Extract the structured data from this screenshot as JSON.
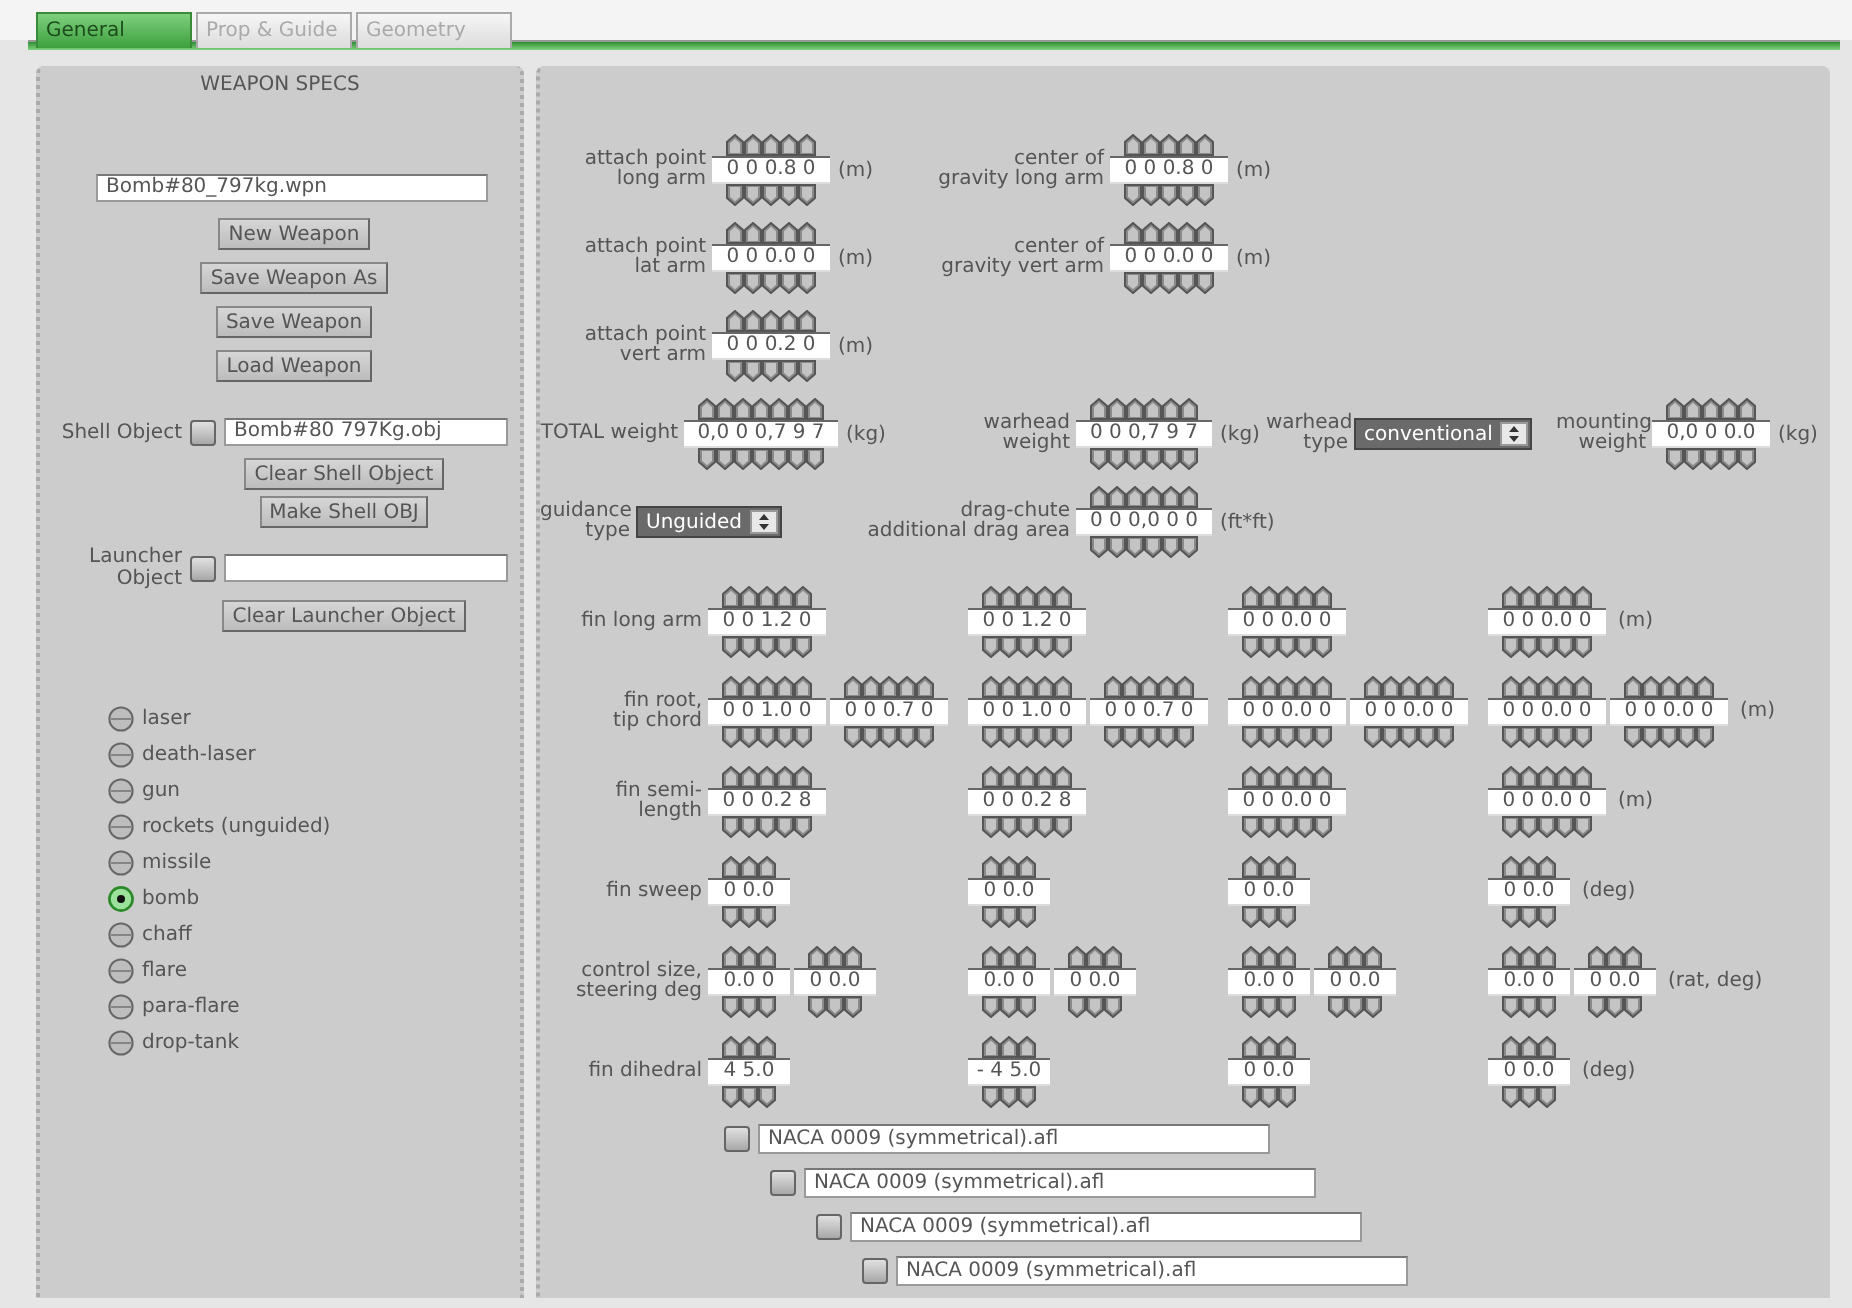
{
  "tabs": [
    {
      "label": "General",
      "selected": true
    },
    {
      "label": "Prop & Guide",
      "selected": false
    },
    {
      "label": "Geometry",
      "selected": false
    }
  ],
  "weapon_specs": {
    "title": "WEAPON SPECS",
    "file": "Bomb#80_797kg.wpn",
    "buttons": [
      "New Weapon",
      "Save Weapon As",
      "Save Weapon",
      "Load Weapon"
    ],
    "shell_object": {
      "label": "Shell Object",
      "checked": false,
      "value": "Bomb#80 797Kg.obj",
      "buttons": [
        "Clear Shell Object",
        "Make Shell OBJ"
      ]
    },
    "launcher_object": {
      "label": "Launcher\nObject",
      "checked": false,
      "buttons": [
        "Clear Launcher Object"
      ]
    },
    "types": [
      {
        "label": "laser",
        "selected": false
      },
      {
        "label": "death-laser",
        "selected": false
      },
      {
        "label": "gun",
        "selected": false
      },
      {
        "label": "rockets (unguided)",
        "selected": false
      },
      {
        "label": "missile",
        "selected": false
      },
      {
        "label": "bomb",
        "selected": true
      },
      {
        "label": "chaff",
        "selected": false
      },
      {
        "label": "flare",
        "selected": false
      },
      {
        "label": "para-flare",
        "selected": false
      },
      {
        "label": "drop-tank",
        "selected": false
      }
    ]
  },
  "specs": [
    {
      "fields": [
        {
          "kind": "spinner",
          "label": "attach point\nlong arm",
          "value": "0 0 0.8 0",
          "unit": "(m)"
        },
        {
          "kind": "spinner",
          "label": "center of\ngravity long arm",
          "value": "0 0 0.8 0",
          "unit": "(m)"
        }
      ]
    },
    {
      "fields": [
        {
          "kind": "spinner",
          "label": "attach point\nlat arm",
          "value": "0 0 0.0 0",
          "unit": "(m)"
        },
        {
          "kind": "spinner",
          "label": "center of\ngravity vert arm",
          "value": "0 0 0.0 0",
          "unit": "(m)"
        }
      ]
    },
    {
      "fields": [
        {
          "kind": "spinner",
          "label": "attach point\nvert arm",
          "value": "0 0 0.2 0",
          "unit": "(m)"
        }
      ]
    },
    {
      "fields": [
        {
          "kind": "spinner",
          "label": "TOTAL weight",
          "value": "0,0 0 0,7 9 7",
          "unit": "(kg)"
        },
        {
          "kind": "spinner",
          "label": "warhead\nweight",
          "value": "0 0 0,7 9 7",
          "unit": "(kg)"
        },
        {
          "kind": "select",
          "label": "warhead\ntype",
          "value": "conventional"
        },
        {
          "kind": "spinner",
          "label": "mounting\nweight",
          "value": "0,0 0 0.0",
          "unit": "(kg)"
        }
      ]
    },
    {
      "fields": [
        {
          "kind": "select",
          "label": "guidance\ntype",
          "value": "Unguided"
        },
        {
          "kind": "spinner",
          "label": "drag-chute\nadditional drag area",
          "value": "0 0 0,0 0 0",
          "unit": "(ft*ft)"
        }
      ]
    }
  ],
  "fin_rows": [
    {
      "label": "fin long arm",
      "columns": [
        [
          "0 0 1.2 0"
        ],
        [
          "0 0 1.2 0"
        ],
        [
          "0 0 0.0 0"
        ],
        [
          "0 0 0.0 0"
        ]
      ],
      "unit": "(m)"
    },
    {
      "label": "fin root,\ntip chord",
      "columns": [
        [
          "0 0 1.0 0",
          "0 0 0.7 0"
        ],
        [
          "0 0 1.0 0",
          "0 0 0.7 0"
        ],
        [
          "0 0 0.0 0",
          "0 0 0.0 0"
        ],
        [
          "0 0 0.0 0",
          "0 0 0.0 0"
        ]
      ],
      "unit": "(m)"
    },
    {
      "label": "fin semi-\nlength",
      "columns": [
        [
          "0 0 0.2 8"
        ],
        [
          "0 0 0.2 8"
        ],
        [
          "0 0 0.0 0"
        ],
        [
          "0 0 0.0 0"
        ]
      ],
      "unit": "(m)"
    },
    {
      "label": "fin sweep",
      "columns": [
        [
          "0 0.0"
        ],
        [
          "0 0.0"
        ],
        [
          "0 0.0"
        ],
        [
          "0 0.0"
        ]
      ],
      "unit": "(deg)"
    },
    {
      "label": "control size,\nsteering deg",
      "columns": [
        [
          "0.0 0",
          "0 0.0"
        ],
        [
          "0.0 0",
          "0 0.0"
        ],
        [
          "0.0 0",
          "0 0.0"
        ],
        [
          "0.0 0",
          "0 0.0"
        ]
      ],
      "unit": "(rat, deg)"
    },
    {
      "label": "fin dihedral",
      "columns": [
        [
          "4 5.0"
        ],
        [
          "- 4 5.0"
        ],
        [
          "0 0.0"
        ],
        [
          "0 0.0"
        ]
      ],
      "unit": "(deg)"
    }
  ],
  "airfoils": [
    {
      "checked": false,
      "value": "NACA 0009 (symmetrical).afl"
    },
    {
      "checked": false,
      "value": "NACA 0009 (symmetrical).afl"
    },
    {
      "checked": false,
      "value": "NACA 0009 (symmetrical).afl"
    },
    {
      "checked": false,
      "value": "NACA 0009 (symmetrical).afl"
    }
  ]
}
